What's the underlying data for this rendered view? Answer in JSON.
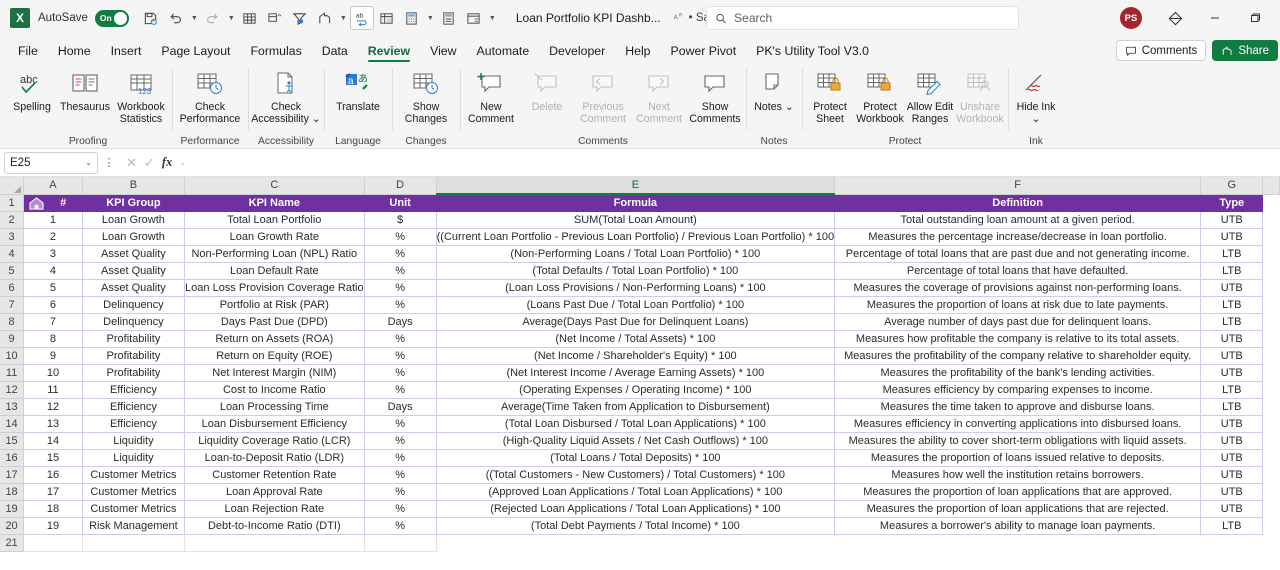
{
  "titlebar": {
    "app_logo": "excel-logo",
    "autosave_label": "AutoSave",
    "autosave_state": "On",
    "document_title": "Loan Portfolio KPI Dashb...",
    "saved_label": "• Saved",
    "search_placeholder": "Search",
    "avatar_initials": "PS",
    "quick_access": [
      {
        "name": "save-icon"
      },
      {
        "name": "undo-icon"
      },
      {
        "name": "redo-icon"
      },
      {
        "name": "table-icon"
      },
      {
        "name": "sort-icon"
      },
      {
        "name": "filter-icon"
      },
      {
        "name": "share-icon"
      },
      {
        "name": "spelling-icon"
      },
      {
        "name": "pivot-table-icon"
      },
      {
        "name": "calculator-icon"
      },
      {
        "name": "calculate-sheet-icon"
      },
      {
        "name": "slicer-icon"
      },
      {
        "name": "more-commands-icon"
      }
    ],
    "window_controls": [
      "minimize",
      "restore"
    ]
  },
  "tabs": {
    "items": [
      "File",
      "Home",
      "Insert",
      "Page Layout",
      "Formulas",
      "Data",
      "Review",
      "View",
      "Automate",
      "Developer",
      "Help",
      "Power Pivot",
      "PK's Utility Tool V3.0"
    ],
    "active": "Review",
    "comments_label": "Comments",
    "share_label": "Share"
  },
  "ribbon": {
    "groups": [
      {
        "label": "Proofing",
        "buttons": [
          {
            "label": "Spelling",
            "icon": "spelling-check-icon",
            "disabled": false
          },
          {
            "label": "Thesaurus",
            "icon": "thesaurus-book-icon",
            "disabled": false
          },
          {
            "label": "Workbook Statistics",
            "icon": "workbook-statistics-icon",
            "disabled": false
          }
        ]
      },
      {
        "label": "Performance",
        "buttons": [
          {
            "label": "Check Performance",
            "icon": "check-performance-icon",
            "disabled": false
          }
        ]
      },
      {
        "label": "Accessibility",
        "buttons": [
          {
            "label": "Check Accessibility ⌄",
            "icon": "check-accessibility-icon",
            "disabled": false
          }
        ]
      },
      {
        "label": "Language",
        "buttons": [
          {
            "label": "Translate",
            "icon": "translate-icon",
            "disabled": false
          }
        ]
      },
      {
        "label": "Changes",
        "buttons": [
          {
            "label": "Show Changes",
            "icon": "show-changes-icon",
            "disabled": false
          }
        ]
      },
      {
        "label": "Comments",
        "buttons": [
          {
            "label": "New Comment",
            "icon": "new-comment-icon",
            "disabled": false
          },
          {
            "label": "Delete",
            "icon": "delete-comment-icon",
            "disabled": true
          },
          {
            "label": "Previous Comment",
            "icon": "previous-comment-icon",
            "disabled": true
          },
          {
            "label": "Next Comment",
            "icon": "next-comment-icon",
            "disabled": true
          },
          {
            "label": "Show Comments",
            "icon": "show-comments-icon",
            "disabled": false
          }
        ]
      },
      {
        "label": "Notes",
        "buttons": [
          {
            "label": "Notes ⌄",
            "icon": "notes-icon",
            "disabled": false
          }
        ]
      },
      {
        "label": "Protect",
        "buttons": [
          {
            "label": "Protect Sheet",
            "icon": "protect-sheet-icon",
            "disabled": false
          },
          {
            "label": "Protect Workbook",
            "icon": "protect-workbook-icon",
            "disabled": false
          },
          {
            "label": "Allow Edit Ranges",
            "icon": "allow-edit-ranges-icon",
            "disabled": false
          },
          {
            "label": "Unshare Workbook",
            "icon": "unshare-workbook-icon",
            "disabled": true
          }
        ]
      },
      {
        "label": "Ink",
        "buttons": [
          {
            "label": "Hide Ink ⌄",
            "icon": "hide-ink-icon",
            "disabled": false
          }
        ]
      }
    ]
  },
  "formula_bar": {
    "name_box_value": "E25",
    "formula_value": "",
    "cancel_icon": "cancel-icon",
    "enter_icon": "enter-icon",
    "fx_icon": "insert-function-icon"
  },
  "grid": {
    "column_letters": [
      "A",
      "B",
      "C",
      "D",
      "E",
      "F",
      "G"
    ],
    "active_column": "E",
    "row_numbers": [
      1,
      2,
      3,
      4,
      5,
      6,
      7,
      8,
      9,
      10,
      11,
      12,
      13,
      14,
      15,
      16,
      17,
      18,
      19,
      20,
      21
    ],
    "headers": [
      "#",
      "KPI Group",
      "KPI Name",
      "Unit",
      "Formula",
      "Definition",
      "Type"
    ],
    "home_icon": "home-icon",
    "rows": [
      [
        "1",
        "Loan Growth",
        "Total Loan Portfolio",
        "$",
        "SUM(Total Loan Amount)",
        "Total outstanding loan amount at a given period.",
        "UTB"
      ],
      [
        "2",
        "Loan Growth",
        "Loan Growth Rate",
        "%",
        "((Current Loan Portfolio - Previous Loan Portfolio) / Previous Loan Portfolio) * 100",
        "Measures the percentage increase/decrease in loan portfolio.",
        "UTB"
      ],
      [
        "3",
        "Asset Quality",
        "Non-Performing Loan (NPL) Ratio",
        "%",
        "(Non-Performing Loans / Total Loan Portfolio) * 100",
        "Percentage of total loans that are past due and not generating income.",
        "LTB"
      ],
      [
        "4",
        "Asset Quality",
        "Loan Default Rate",
        "%",
        "(Total Defaults / Total Loan Portfolio) * 100",
        "Percentage of total loans that have defaulted.",
        "LTB"
      ],
      [
        "5",
        "Asset Quality",
        "Loan Loss Provision Coverage Ratio",
        "%",
        "(Loan Loss Provisions / Non-Performing Loans) * 100",
        "Measures the coverage of provisions against non-performing loans.",
        "UTB"
      ],
      [
        "6",
        "Delinquency",
        "Portfolio at Risk (PAR)",
        "%",
        "(Loans Past Due / Total Loan Portfolio) * 100",
        "Measures the proportion of loans at risk due to late payments.",
        "LTB"
      ],
      [
        "7",
        "Delinquency",
        "Days Past Due (DPD)",
        "Days",
        "Average(Days Past Due for Delinquent Loans)",
        "Average number of days past due for delinquent loans.",
        "LTB"
      ],
      [
        "8",
        "Profitability",
        "Return on Assets (ROA)",
        "%",
        "(Net Income / Total Assets) * 100",
        "Measures how profitable the company is relative to its total assets.",
        "UTB"
      ],
      [
        "9",
        "Profitability",
        "Return on Equity (ROE)",
        "%",
        "(Net Income / Shareholder's Equity) * 100",
        "Measures the profitability of the company relative to shareholder equity.",
        "UTB"
      ],
      [
        "10",
        "Profitability",
        "Net Interest Margin (NIM)",
        "%",
        "(Net Interest Income / Average Earning Assets) * 100",
        "Measures the profitability of the bank's lending activities.",
        "UTB"
      ],
      [
        "11",
        "Efficiency",
        "Cost to Income Ratio",
        "%",
        "(Operating Expenses / Operating Income) * 100",
        "Measures efficiency by comparing expenses to income.",
        "LTB"
      ],
      [
        "12",
        "Efficiency",
        "Loan Processing Time",
        "Days",
        "Average(Time Taken from Application to Disbursement)",
        "Measures the time taken to approve and disburse loans.",
        "LTB"
      ],
      [
        "13",
        "Efficiency",
        "Loan Disbursement Efficiency",
        "%",
        "(Total Loan Disbursed / Total Loan Applications) * 100",
        "Measures efficiency in converting applications into disbursed loans.",
        "UTB"
      ],
      [
        "14",
        "Liquidity",
        "Liquidity Coverage Ratio (LCR)",
        "%",
        "(High-Quality Liquid Assets / Net Cash Outflows) * 100",
        "Measures the ability to cover short-term obligations with liquid assets.",
        "UTB"
      ],
      [
        "15",
        "Liquidity",
        "Loan-to-Deposit Ratio (LDR)",
        "%",
        "(Total Loans / Total Deposits) * 100",
        "Measures the proportion of loans issued relative to deposits.",
        "UTB"
      ],
      [
        "16",
        "Customer Metrics",
        "Customer Retention Rate",
        "%",
        "((Total Customers - New Customers) / Total Customers) * 100",
        "Measures how well the institution retains borrowers.",
        "UTB"
      ],
      [
        "17",
        "Customer Metrics",
        "Loan Approval Rate",
        "%",
        "(Approved Loan Applications / Total Loan Applications) * 100",
        "Measures the proportion of loan applications that are approved.",
        "UTB"
      ],
      [
        "18",
        "Customer Metrics",
        "Loan Rejection Rate",
        "%",
        "(Rejected Loan Applications / Total Loan Applications) * 100",
        "Measures the proportion of loan applications that are rejected.",
        "UTB"
      ],
      [
        "19",
        "Risk Management",
        "Debt-to-Income Ratio (DTI)",
        "%",
        "(Total Debt Payments / Total Income) * 100",
        "Measures a borrower's ability to manage loan payments.",
        "LTB"
      ]
    ]
  },
  "colors": {
    "header_purple": "#7030a0",
    "excel_green": "#107c41",
    "accent_green": "#0f6b3d",
    "avatar_red": "#a4262c",
    "gridline": "#ccccf2"
  }
}
